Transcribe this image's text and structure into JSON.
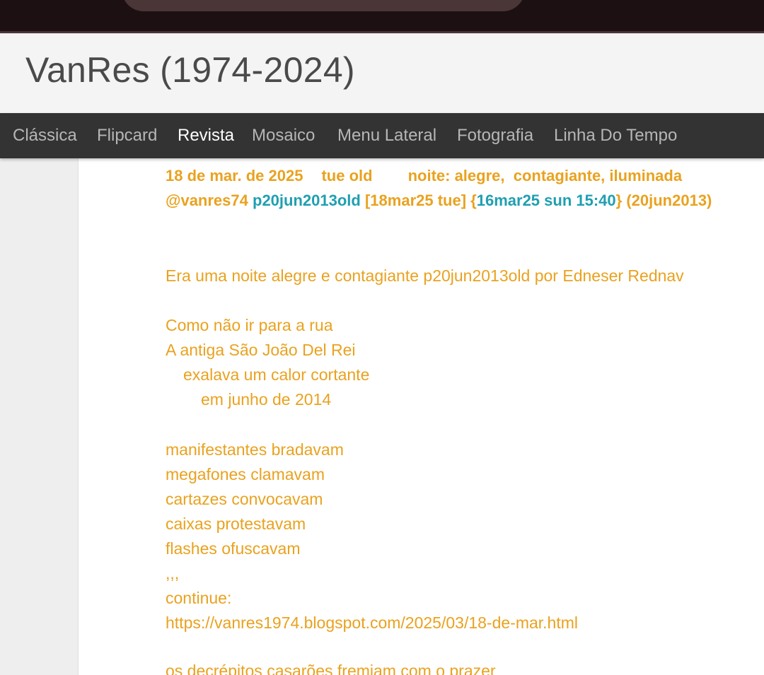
{
  "site": {
    "title": "VanRes (1974-2024)"
  },
  "nav": {
    "items": [
      {
        "label": "Clássica",
        "active": false
      },
      {
        "label": "Flipcard",
        "active": false
      },
      {
        "label": "Revista",
        "active": true
      },
      {
        "label": "Mosaico",
        "active": false
      },
      {
        "label": "Menu Lateral",
        "active": false
      },
      {
        "label": "Fotografia",
        "active": false
      },
      {
        "label": "Linha Do Tempo",
        "active": false
      }
    ]
  },
  "post": {
    "header_line1": {
      "date": "18 de mar. de 2025",
      "tag": "tue old",
      "subtitle": "noite: alegre,  contagiante, iluminada"
    },
    "header_line2": {
      "handle": "@vanres74",
      "code": "p20jun2013old",
      "bracket": "[18mar25 tue]",
      "brace_open": "{",
      "timestamp": "16mar25 sun 15:40",
      "brace_close": "}",
      "paren": "(20jun2013)"
    },
    "intro": "Era uma noite alegre e contagiante p20jun2013old por Edneser Rednav",
    "stanza1": [
      "Como não ir para a rua",
      "A antiga São João Del Rei",
      "exalava um calor cortante",
      "em junho de 2014"
    ],
    "stanza2": [
      "manifestantes bradavam",
      "megafones clamavam",
      "cartazes convocavam",
      "caixas protestavam",
      "flashes ofuscavam",
      ",,,"
    ],
    "continue_label": "continue:",
    "continue_url": "https://vanres1974.blogspot.com/2025/03/18-de-mar.html",
    "next_line": "os decrépitos casarões fremiam com o prazer"
  },
  "colors": {
    "accent_orange": "#e9a21f",
    "accent_teal": "#1f9fb0",
    "navbar_bg": "#333333",
    "header_bg": "#f4f4f4",
    "topbar_bg": "#1d1012"
  }
}
